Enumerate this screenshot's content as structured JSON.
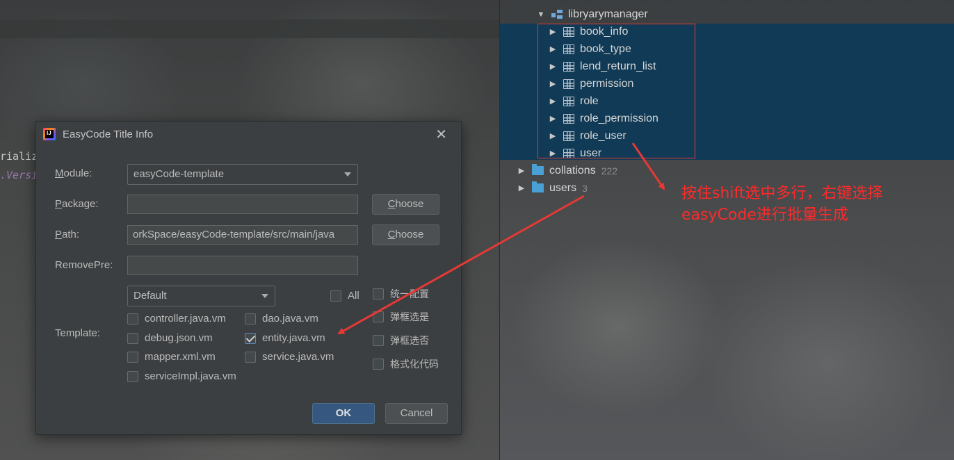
{
  "editor": {
    "code_line_1": "rializ",
    "code_line_2": ".Versi"
  },
  "db_tree": {
    "schema": "libryarymanager",
    "tables": [
      "book_info",
      "book_type",
      "lend_return_list",
      "permission",
      "role",
      "role_permission",
      "role_user",
      "user"
    ],
    "folders": [
      {
        "label": "collations",
        "count": "222"
      },
      {
        "label": "users",
        "count": "3"
      }
    ]
  },
  "annotation": {
    "line1": "按住shift选中多行，右键选择",
    "line2": "easyCode进行批量生成",
    "color": "#ff2a2a"
  },
  "dialog": {
    "title": "EasyCode Title Info",
    "module_label_mnemonic": "M",
    "module_label_rest": "odule:",
    "module_value": "easyCode-template",
    "package_label_mnemonic": "P",
    "package_label_rest": "ackage:",
    "package_value": "",
    "path_label_mnemonic": "P",
    "path_label_rest": "ath:",
    "path_value": "orkSpace/easyCode-template/src/main/java",
    "removepre_label": "RemovePre:",
    "removepre_value": "",
    "choose_mnemonic": "C",
    "choose_rest": "hoose",
    "template_label": "Template:",
    "template_group": "Default",
    "all_label": "All",
    "templates": [
      {
        "label": "controller.java.vm",
        "checked": false
      },
      {
        "label": "dao.java.vm",
        "checked": false
      },
      {
        "label": "debug.json.vm",
        "checked": false
      },
      {
        "label": "entity.java.vm",
        "checked": true
      },
      {
        "label": "mapper.xml.vm",
        "checked": false
      },
      {
        "label": "service.java.vm",
        "checked": false
      },
      {
        "label": "serviceImpl.java.vm",
        "checked": false
      }
    ],
    "options": [
      {
        "label": "统一配置",
        "checked": false
      },
      {
        "label": "弹框选是",
        "checked": false
      },
      {
        "label": "弹框选否",
        "checked": false
      },
      {
        "label": "格式化代码",
        "checked": false
      }
    ],
    "ok_label": "OK",
    "cancel_label": "Cancel"
  }
}
